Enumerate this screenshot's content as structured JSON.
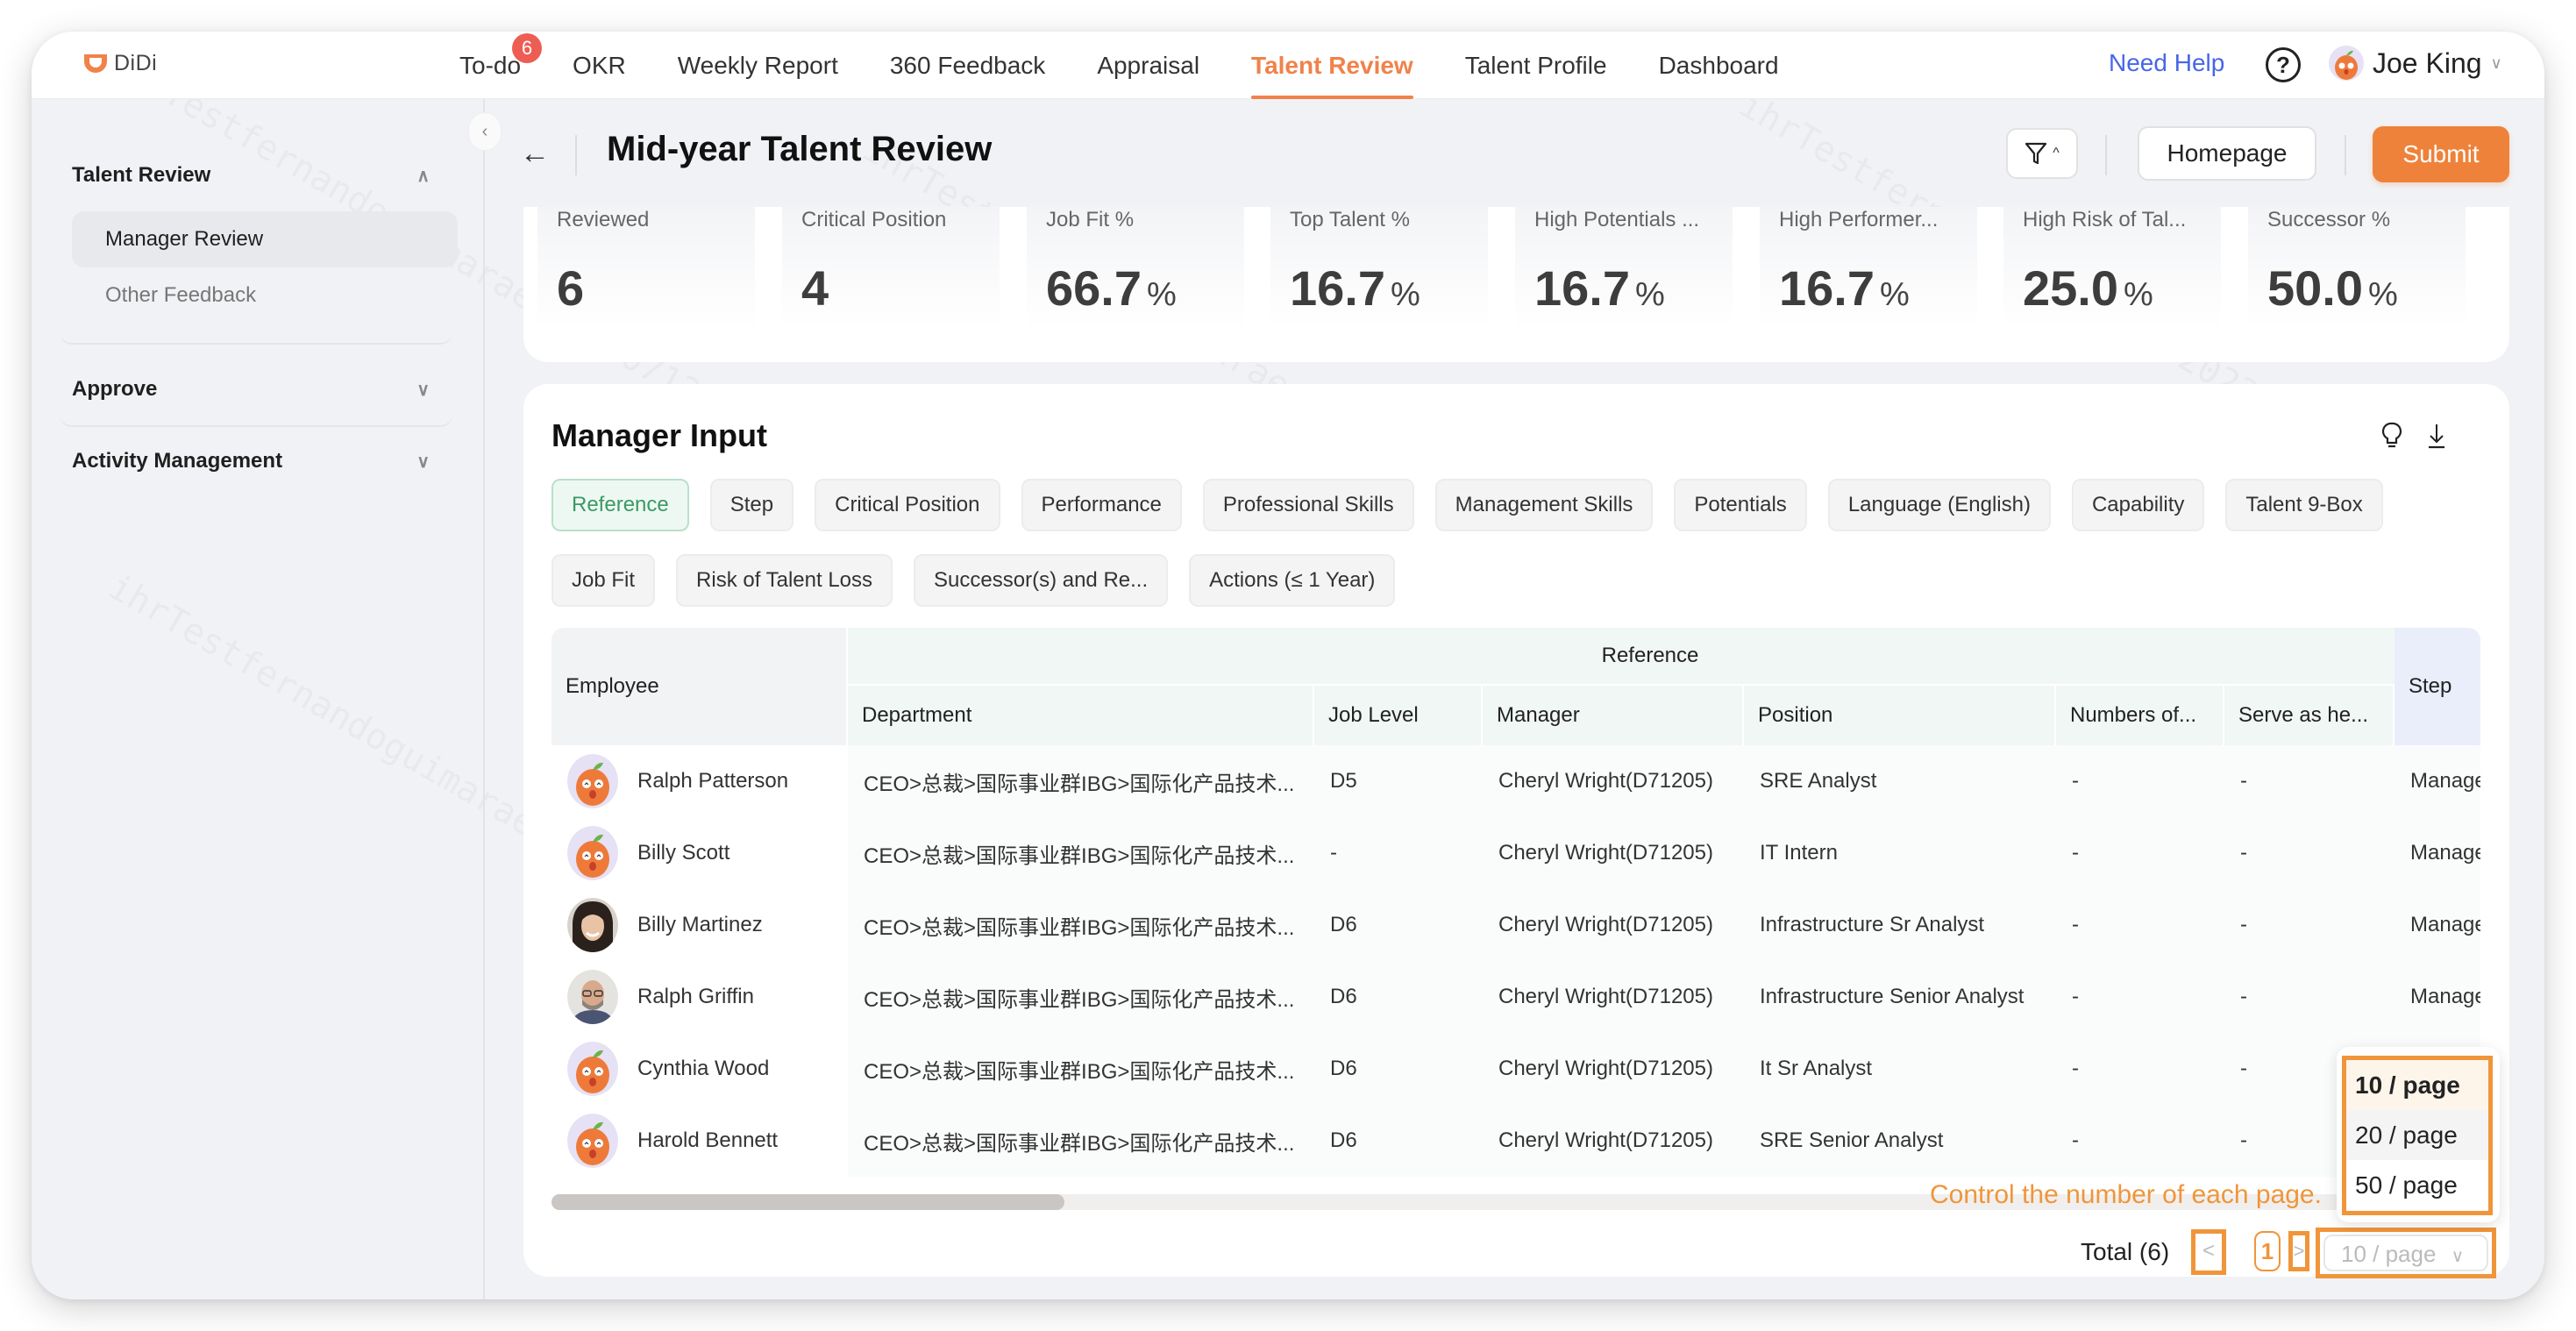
{
  "app": {
    "logo_text": "DiDi",
    "brand_color": "#f0824a"
  },
  "nav": {
    "items": [
      {
        "label": "To-do",
        "badge": "6"
      },
      {
        "label": "OKR"
      },
      {
        "label": "Weekly Report"
      },
      {
        "label": "360 Feedback"
      },
      {
        "label": "Appraisal"
      },
      {
        "label": "Talent Review",
        "active": true
      },
      {
        "label": "Talent Profile"
      },
      {
        "label": "Dashboard"
      }
    ],
    "help_label": "Need Help",
    "help_icon": "question-circle-icon",
    "user_name": "Joe King"
  },
  "sidebar": {
    "groups": [
      {
        "label": "Talent Review",
        "expanded": true,
        "items": [
          {
            "label": "Manager Review",
            "active": true
          },
          {
            "label": "Other Feedback"
          }
        ]
      },
      {
        "label": "Approve",
        "expanded": false
      },
      {
        "label": "Activity Management",
        "expanded": false
      }
    ]
  },
  "header": {
    "title": "Mid-year Talent Review",
    "homepage_label": "Homepage",
    "submit_label": "Submit"
  },
  "stats": [
    {
      "label": "Reviewed",
      "value": "6",
      "unit": ""
    },
    {
      "label": "Critical Position",
      "value": "4",
      "unit": ""
    },
    {
      "label": "Job Fit %",
      "value": "66.7",
      "unit": "%"
    },
    {
      "label": "Top Talent %",
      "value": "16.7",
      "unit": "%"
    },
    {
      "label": "High Potentials ...",
      "value": "16.7",
      "unit": "%"
    },
    {
      "label": "High Performer...",
      "value": "16.7",
      "unit": "%"
    },
    {
      "label": "High Risk of Tal...",
      "value": "25.0",
      "unit": "%"
    },
    {
      "label": "Successor %",
      "value": "50.0",
      "unit": "%"
    }
  ],
  "manager_input": {
    "title": "Manager Input",
    "tabs": [
      {
        "label": "Reference",
        "active": true
      },
      {
        "label": "Step"
      },
      {
        "label": "Critical Position"
      },
      {
        "label": "Performance"
      },
      {
        "label": "Professional Skills"
      },
      {
        "label": "Management Skills"
      },
      {
        "label": "Potentials"
      },
      {
        "label": "Language (English)"
      },
      {
        "label": "Capability"
      },
      {
        "label": "Talent 9-Box"
      },
      {
        "label": "Job Fit"
      },
      {
        "label": "Risk of Talent Loss"
      },
      {
        "label": "Successor(s) and Re..."
      },
      {
        "label": "Actions (≤ 1 Year)"
      }
    ],
    "table": {
      "employee_header": "Employee",
      "group_header": "Reference",
      "step_header": "Step",
      "columns": [
        "Department",
        "Job Level",
        "Manager",
        "Position",
        "Numbers of...",
        "Serve as he..."
      ],
      "rows": [
        {
          "employee": "Ralph Patterson",
          "avatar": "orange-mascot",
          "department": "CEO>总裁>国际事业群IBG>国际化产品技术...",
          "job_level": "D5",
          "manager": "Cheryl Wright(D71205)",
          "position": "SRE Analyst",
          "numbers": "-",
          "serve": "-",
          "step": "Manage"
        },
        {
          "employee": "Billy Scott",
          "avatar": "orange-mascot",
          "department": "CEO>总裁>国际事业群IBG>国际化产品技术...",
          "job_level": "-",
          "manager": "Cheryl Wright(D71205)",
          "position": "IT Intern",
          "numbers": "-",
          "serve": "-",
          "step": "Manage"
        },
        {
          "employee": "Billy Martinez",
          "avatar": "photo-woman",
          "department": "CEO>总裁>国际事业群IBG>国际化产品技术...",
          "job_level": "D6",
          "manager": "Cheryl Wright(D71205)",
          "position": "Infrastructure Sr Analyst",
          "numbers": "-",
          "serve": "-",
          "step": "Manage"
        },
        {
          "employee": "Ralph Griffin",
          "avatar": "photo-man",
          "department": "CEO>总裁>国际事业群IBG>国际化产品技术...",
          "job_level": "D6",
          "manager": "Cheryl Wright(D71205)",
          "position": "Infrastructure Senior Analyst",
          "numbers": "-",
          "serve": "-",
          "step": "Manage"
        },
        {
          "employee": "Cynthia Wood",
          "avatar": "orange-mascot",
          "department": "CEO>总裁>国际事业群IBG>国际化产品技术...",
          "job_level": "D6",
          "manager": "Cheryl Wright(D71205)",
          "position": "It Sr Analyst",
          "numbers": "-",
          "serve": "-",
          "step": ""
        },
        {
          "employee": "Harold Bennett",
          "avatar": "orange-mascot",
          "department": "CEO>总裁>国际事业群IBG>国际化产品技术...",
          "job_level": "D6",
          "manager": "Cheryl Wright(D71205)",
          "position": "SRE Senior Analyst",
          "numbers": "-",
          "serve": "-",
          "step": ""
        }
      ]
    },
    "annotation": "Control the number of each page.",
    "page_size_options": [
      "10 / page",
      "20 / page",
      "50 / page"
    ],
    "pagination": {
      "total_label": "Total (6)",
      "current_page": "1",
      "page_size": "10 / page",
      "prev": "<",
      "next": ">"
    },
    "highlight_color": "#f0953a"
  }
}
